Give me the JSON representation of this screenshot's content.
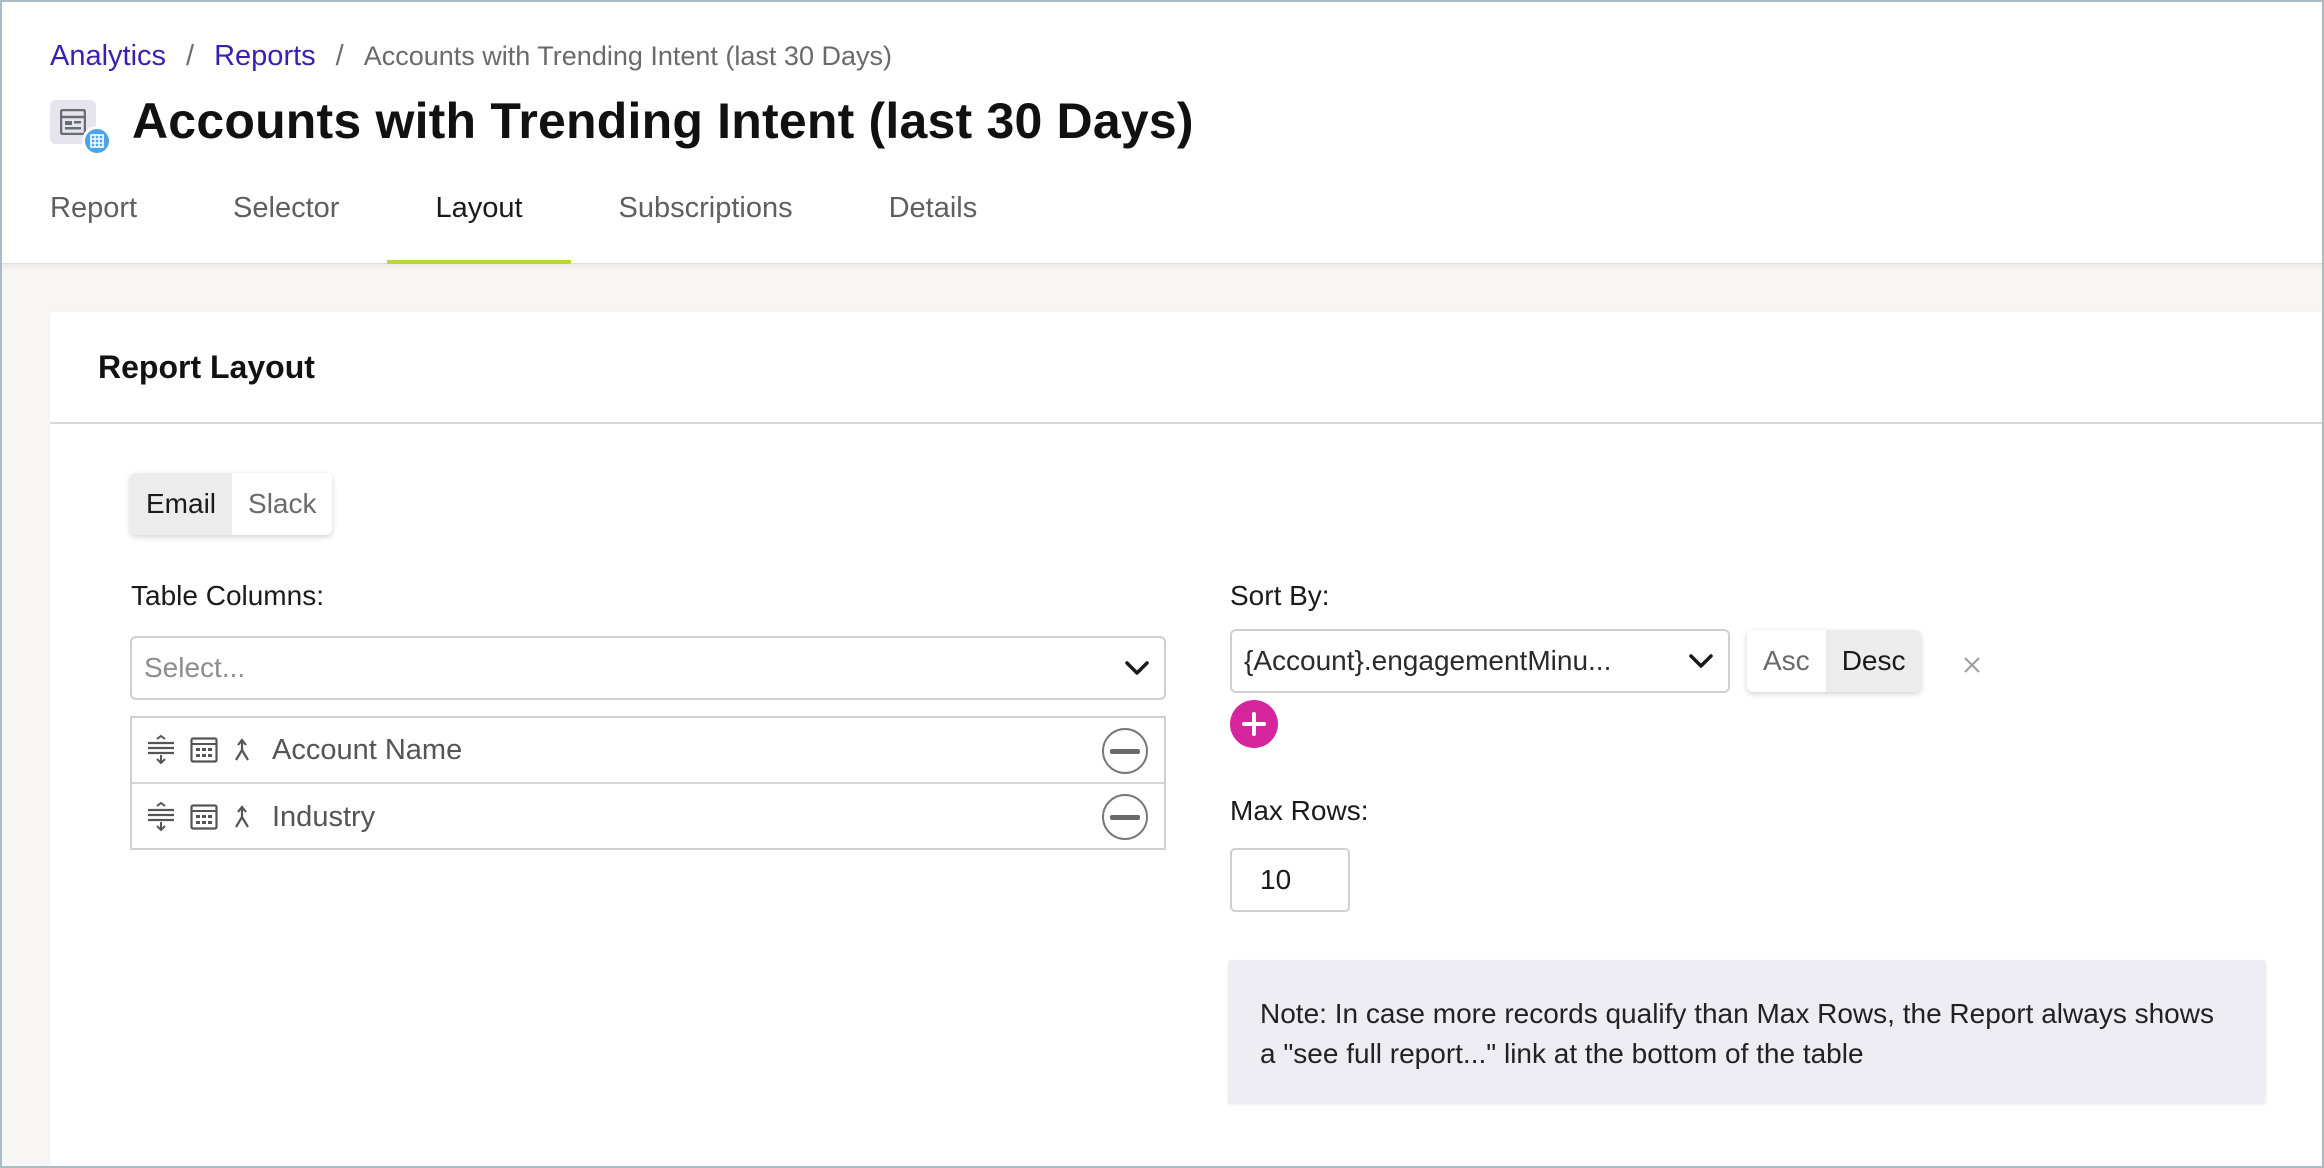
{
  "breadcrumb": {
    "items": [
      "Analytics",
      "Reports"
    ],
    "separator": "/",
    "current": "Accounts with Trending Intent (last 30 Days)"
  },
  "page": {
    "title": "Accounts with Trending Intent (last 30 Days)",
    "icon": "report-table-icon"
  },
  "tabs": [
    {
      "label": "Report",
      "active": false
    },
    {
      "label": "Selector",
      "active": false
    },
    {
      "label": "Layout",
      "active": true
    },
    {
      "label": "Subscriptions",
      "active": false
    },
    {
      "label": "Details",
      "active": false
    }
  ],
  "card": {
    "title": "Report Layout",
    "channel_toggle": {
      "options": [
        "Email",
        "Slack"
      ],
      "selected": "Email"
    },
    "table_columns": {
      "label": "Table Columns:",
      "placeholder": "Select...",
      "rows": [
        {
          "name": "Account Name",
          "icons": [
            "drag-handle-icon",
            "table-icon",
            "merge-icon"
          ]
        },
        {
          "name": "Industry",
          "icons": [
            "drag-handle-icon",
            "table-icon",
            "merge-icon"
          ]
        }
      ]
    },
    "sort_by": {
      "label": "Sort By:",
      "value": "{Account}.engagementMinu...",
      "order_options": [
        "Asc",
        "Desc"
      ],
      "selected_order": "Desc"
    },
    "max_rows": {
      "label": "Max Rows:",
      "value": "10"
    },
    "note": "Note: In case more records qualify than Max Rows, the Report always shows a \"see full report...\" link at the bottom of the table"
  },
  "colors": {
    "link": "#3a1fb5",
    "tab_underline": "#b9d63a",
    "add_button": "#d6269d",
    "badge": "#4ba3e8",
    "note_bg": "#efedf4"
  }
}
